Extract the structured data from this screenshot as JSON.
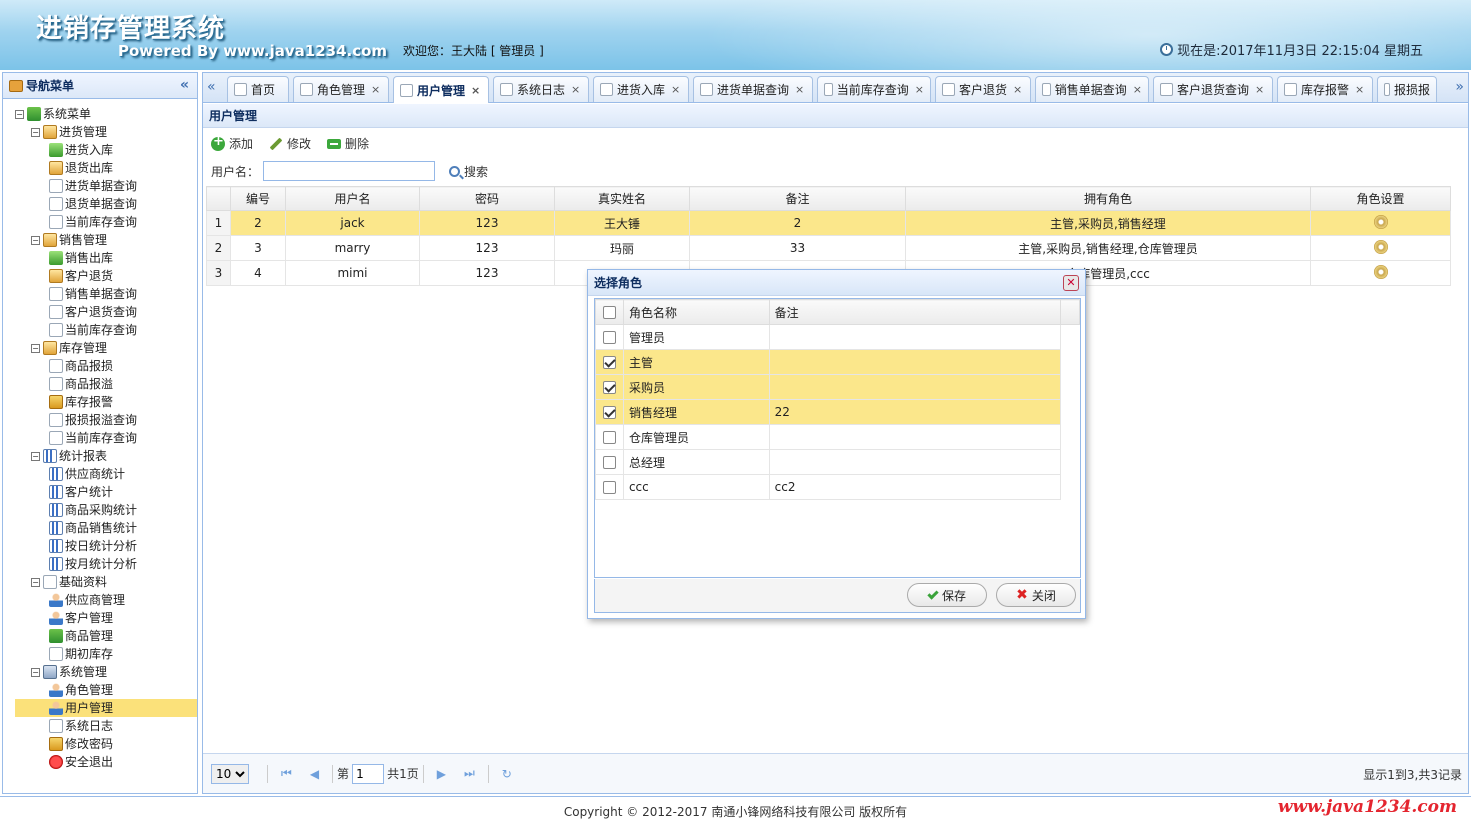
{
  "header": {
    "title": "进销存管理系统",
    "powered": "Powered By www.java1234.com",
    "welcome": "欢迎您：王大陆 [ 管理员 ]",
    "clock": "现在是:2017年11月3日 22:15:04 星期五"
  },
  "nav": {
    "title": "导航菜单",
    "collapse": "«",
    "tree": [
      {
        "label": "系统菜单",
        "level": 0,
        "icon": "grn",
        "box": "−"
      },
      {
        "label": "进货管理",
        "level": 1,
        "icon": "fold",
        "box": "−"
      },
      {
        "label": "进货入库",
        "level": 2,
        "icon": "arr"
      },
      {
        "label": "退货出库",
        "level": 2,
        "icon": "fold"
      },
      {
        "label": "进货单据查询",
        "level": 2,
        "icon": "doc"
      },
      {
        "label": "退货单据查询",
        "level": 2,
        "icon": "doc"
      },
      {
        "label": "当前库存查询",
        "level": 2,
        "icon": "doc"
      },
      {
        "label": "销售管理",
        "level": 1,
        "icon": "fold",
        "box": "−"
      },
      {
        "label": "销售出库",
        "level": 2,
        "icon": "arr"
      },
      {
        "label": "客户退货",
        "level": 2,
        "icon": "fold"
      },
      {
        "label": "销售单据查询",
        "level": 2,
        "icon": "doc"
      },
      {
        "label": "客户退货查询",
        "level": 2,
        "icon": "doc"
      },
      {
        "label": "当前库存查询",
        "level": 2,
        "icon": "doc"
      },
      {
        "label": "库存管理",
        "level": 1,
        "icon": "fold",
        "box": "−"
      },
      {
        "label": "商品报损",
        "level": 2,
        "icon": "doc"
      },
      {
        "label": "商品报溢",
        "level": 2,
        "icon": "doc"
      },
      {
        "label": "库存报警",
        "level": 2,
        "icon": "lock"
      },
      {
        "label": "报损报溢查询",
        "level": 2,
        "icon": "doc"
      },
      {
        "label": "当前库存查询",
        "level": 2,
        "icon": "doc"
      },
      {
        "label": "统计报表",
        "level": 1,
        "icon": "bar",
        "box": "−"
      },
      {
        "label": "供应商统计",
        "level": 2,
        "icon": "bar"
      },
      {
        "label": "客户统计",
        "level": 2,
        "icon": "bar"
      },
      {
        "label": "商品采购统计",
        "level": 2,
        "icon": "bar"
      },
      {
        "label": "商品销售统计",
        "level": 2,
        "icon": "bar"
      },
      {
        "label": "按日统计分析",
        "level": 2,
        "icon": "bar"
      },
      {
        "label": "按月统计分析",
        "level": 2,
        "icon": "bar"
      },
      {
        "label": "基础资料",
        "level": 1,
        "icon": "doc",
        "box": "−"
      },
      {
        "label": "供应商管理",
        "level": 2,
        "icon": "usr"
      },
      {
        "label": "客户管理",
        "level": 2,
        "icon": "usr"
      },
      {
        "label": "商品管理",
        "level": 2,
        "icon": "grn"
      },
      {
        "label": "期初库存",
        "level": 2,
        "icon": "doc"
      },
      {
        "label": "系统管理",
        "level": 1,
        "icon": "pc",
        "box": "−"
      },
      {
        "label": "角色管理",
        "level": 2,
        "icon": "usr"
      },
      {
        "label": "用户管理",
        "level": 2,
        "icon": "usr",
        "selected": true
      },
      {
        "label": "系统日志",
        "level": 2,
        "icon": "doc"
      },
      {
        "label": "修改密码",
        "level": 2,
        "icon": "lock"
      },
      {
        "label": "安全退出",
        "level": 2,
        "icon": "red"
      }
    ]
  },
  "tabs": [
    {
      "label": "首页",
      "closable": false
    },
    {
      "label": "角色管理",
      "closable": true
    },
    {
      "label": "用户管理",
      "closable": true,
      "active": true
    },
    {
      "label": "系统日志",
      "closable": true
    },
    {
      "label": "进货入库",
      "closable": true
    },
    {
      "label": "进货单据查询",
      "closable": true
    },
    {
      "label": "当前库存查询",
      "closable": true
    },
    {
      "label": "客户退货",
      "closable": true
    },
    {
      "label": "销售单据查询",
      "closable": true
    },
    {
      "label": "客户退货查询",
      "closable": true
    },
    {
      "label": "库存报警",
      "closable": true
    },
    {
      "label": "报损报",
      "closable": false
    }
  ],
  "page": {
    "title": "用户管理",
    "toolbar": {
      "add": "添加",
      "edit": "修改",
      "delete": "删除"
    },
    "search": {
      "label": "用户名：",
      "button": "搜索",
      "value": ""
    },
    "columns": [
      "编号",
      "用户名",
      "密码",
      "真实姓名",
      "备注",
      "拥有角色",
      "角色设置"
    ],
    "rows": [
      {
        "n": "1",
        "id": "2",
        "user": "jack",
        "pwd": "123",
        "real": "王大锤",
        "note": "2",
        "roles": "主管,采购员,销售经理",
        "hl": true
      },
      {
        "n": "2",
        "id": "3",
        "user": "marry",
        "pwd": "123",
        "real": "玛丽",
        "note": "33",
        "roles": "主管,采购员,销售经理,仓库管理员",
        "hl": false
      },
      {
        "n": "3",
        "id": "4",
        "user": "mimi",
        "pwd": "123",
        "real": "",
        "note": "",
        "roles": "仓库管理员,ccc",
        "hl": false
      }
    ],
    "pager": {
      "size": "10",
      "page_prefix": "第",
      "page": "1",
      "total_pages": "共1页",
      "info": "显示1到3,共3记录"
    }
  },
  "dialog": {
    "title": "选择角色",
    "columns": [
      "角色名称",
      "备注"
    ],
    "rows": [
      {
        "name": "管理员",
        "note": "",
        "checked": false
      },
      {
        "name": "主管",
        "note": "",
        "checked": true
      },
      {
        "name": "采购员",
        "note": "",
        "checked": true
      },
      {
        "name": "销售经理",
        "note": "22",
        "checked": true
      },
      {
        "name": "仓库管理员",
        "note": "",
        "checked": false
      },
      {
        "name": "总经理",
        "note": "",
        "checked": false
      },
      {
        "name": "ccc",
        "note": "cc2",
        "checked": false
      }
    ],
    "save": "保存",
    "close": "关闭"
  },
  "footer": {
    "copyright": "Copyright © 2012-2017 南通小锋网络科技有限公司 版权所有",
    "watermark": "www.java1234.com"
  }
}
